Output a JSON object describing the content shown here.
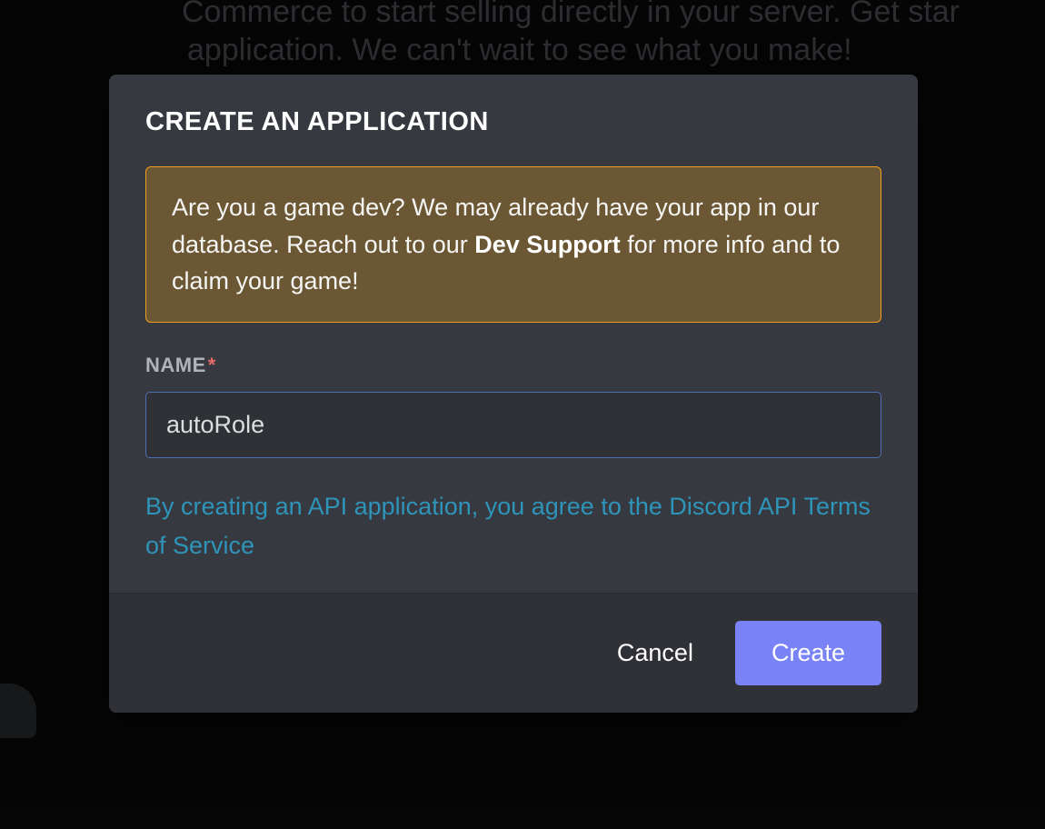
{
  "backdrop": {
    "line1": "Commerce to start selling directly in your server. Get star",
    "line2": "application. We can't wait to see what you make!"
  },
  "modal": {
    "title": "Create an Application",
    "notice": {
      "pre": "Are you a game dev? We may already have your app in our database. Reach out to our ",
      "bold": "Dev Support",
      "post": " for more info and to claim your game!"
    },
    "name_label": "Name",
    "required_star": "*",
    "name_value": "autoRole",
    "tos_text": "By creating an API application, you agree to the Discord API Terms of Service",
    "cancel_label": "Cancel",
    "create_label": "Create"
  }
}
